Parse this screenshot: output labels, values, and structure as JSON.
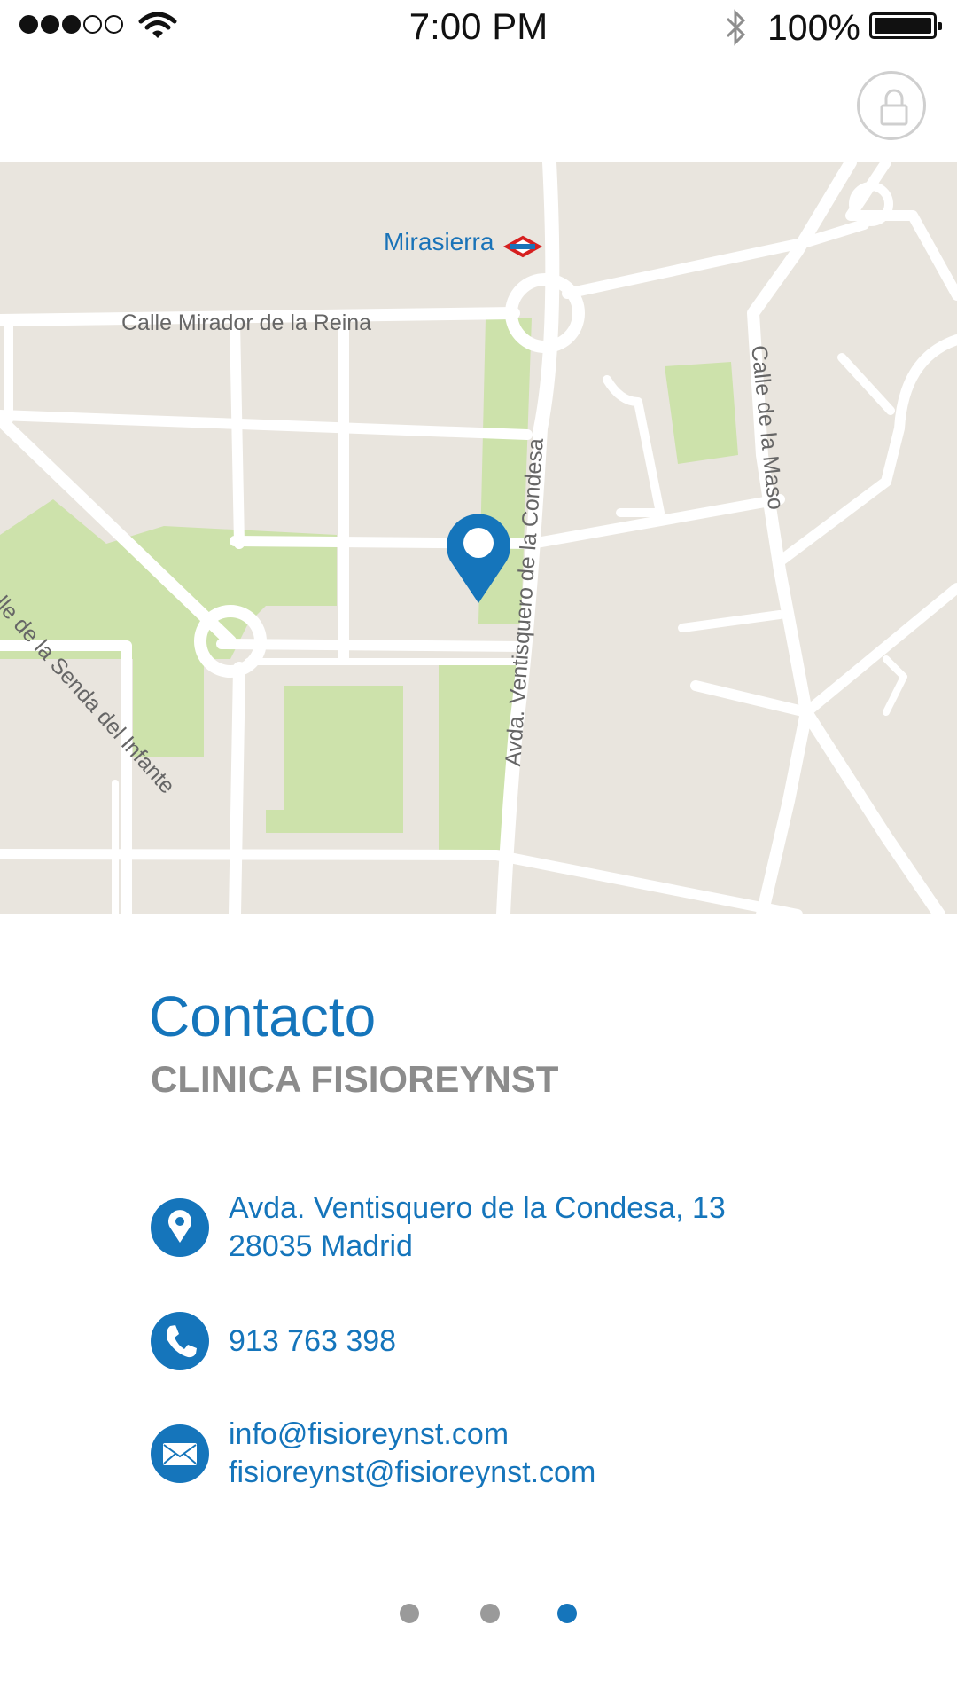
{
  "status_bar": {
    "time": "7:00 PM",
    "battery_percent": "100%",
    "signal_bars": 3,
    "signal_total": 5,
    "icons": [
      "wifi-icon",
      "bluetooth-icon",
      "battery-icon"
    ]
  },
  "header": {
    "lock_icon": "lock-icon"
  },
  "map": {
    "labels": {
      "metro_station": "Mirasierra",
      "street_mirador": "Calle Mirador de la Reina",
      "street_senda": "Calle de la Senda del Infante",
      "street_condesa": "Avda. Ventisquero de la Condesa",
      "street_maso": "Calle de la Maso"
    },
    "marker_icon": "location-pin-icon",
    "colors": {
      "land": "#e9e5de",
      "park": "#cde2ab",
      "road": "#ffffff"
    }
  },
  "contact": {
    "title": "Contacto",
    "subtitle": "CLINICA FISIOREYNST",
    "address": {
      "line1": "Avda. Ventisquero de la Condesa, 13",
      "line2": "28035 Madrid",
      "icon": "location-icon"
    },
    "phone": {
      "number": "913 763 398",
      "icon": "phone-icon"
    },
    "email": {
      "line1": "info@fisioreynst.com",
      "line2": "fisioreynst@fisioreynst.com",
      "icon": "mail-icon"
    }
  },
  "pagination": {
    "total": 3,
    "current": 3
  },
  "colors": {
    "accent": "#1575bb",
    "secondary_text": "#8c8c8c"
  }
}
